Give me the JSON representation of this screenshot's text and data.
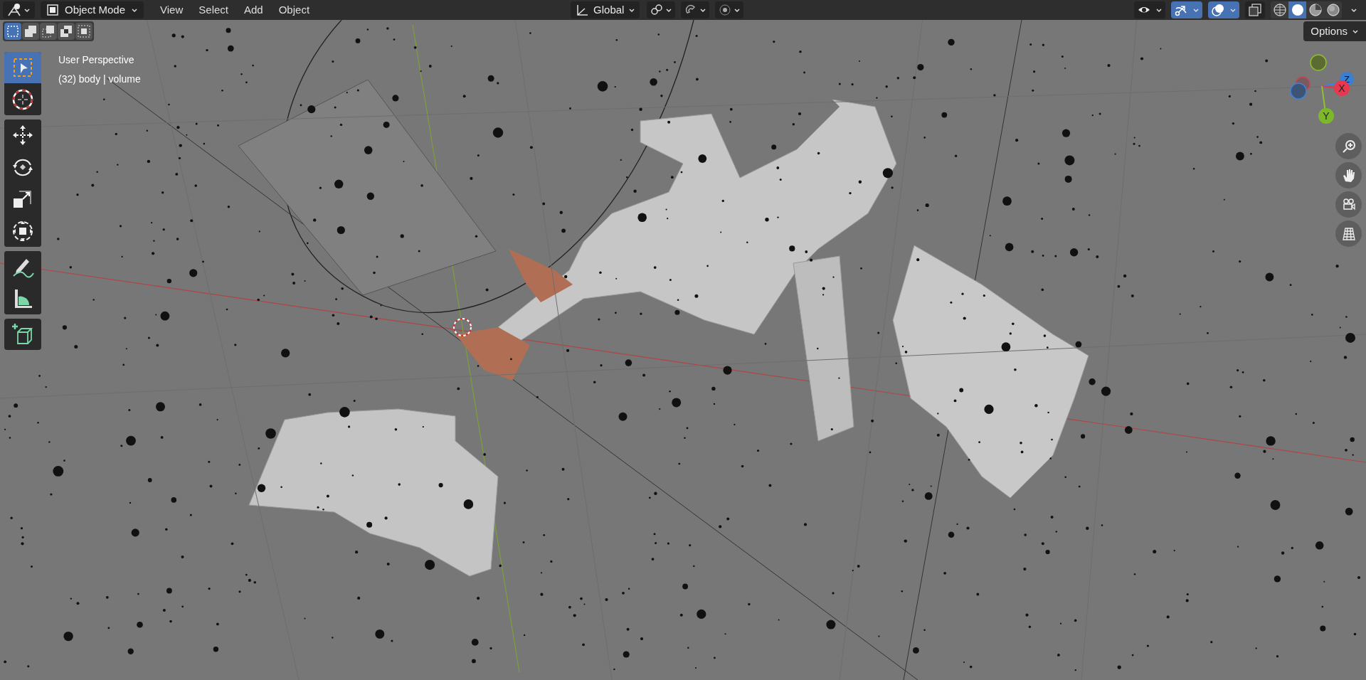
{
  "header": {
    "mode": "Object Mode",
    "menus": [
      "View",
      "Select",
      "Add",
      "Object"
    ],
    "transform_orientation": "Global",
    "toggles": [
      {
        "kind": "pivot",
        "on": false
      },
      {
        "kind": "snap",
        "on": false
      },
      {
        "kind": "proportional",
        "on": false
      }
    ],
    "right_toggles": [
      {
        "kind": "visibility",
        "on": false
      },
      {
        "kind": "gizmo",
        "on": true
      },
      {
        "kind": "overlays",
        "on": true
      },
      {
        "kind": "xray",
        "on": false
      }
    ],
    "shading": [
      {
        "kind": "wireframe",
        "selected": false
      },
      {
        "kind": "solid",
        "selected": true
      },
      {
        "kind": "material",
        "selected": false
      },
      {
        "kind": "rendered",
        "selected": false
      }
    ]
  },
  "select_modes": [
    {
      "kind": "new",
      "selected": true
    },
    {
      "kind": "extend",
      "selected": false
    },
    {
      "kind": "subtract",
      "selected": false
    },
    {
      "kind": "invert",
      "selected": false
    },
    {
      "kind": "intersect",
      "selected": false
    }
  ],
  "toolbar": [
    [
      {
        "kind": "select",
        "selected": true
      },
      {
        "kind": "cursor",
        "selected": false
      }
    ],
    [
      {
        "kind": "move",
        "selected": false
      },
      {
        "kind": "rotate",
        "selected": false
      },
      {
        "kind": "scale",
        "selected": false
      },
      {
        "kind": "transform",
        "selected": false
      }
    ],
    [
      {
        "kind": "annotate",
        "selected": false
      },
      {
        "kind": "measure",
        "selected": false
      }
    ],
    [
      {
        "kind": "add-cube",
        "selected": false
      }
    ]
  ],
  "viewport": {
    "view_name": "User Perspective",
    "object_info": "(32) body | volume",
    "options": "Options"
  },
  "gizmo": {
    "x": "X",
    "y": "Y",
    "z": "Z"
  }
}
